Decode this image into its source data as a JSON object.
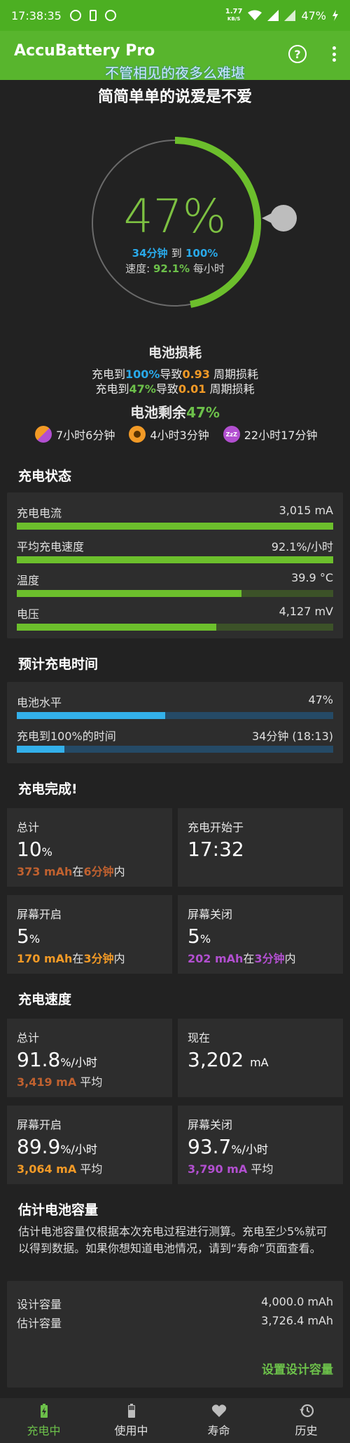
{
  "statusbar": {
    "time": "17:38:35",
    "netspeed_value": "1.77",
    "netspeed_unit": "KB/S",
    "battery": "47%"
  },
  "appbar": {
    "title": "AccuBattery Pro",
    "help_glyph": "?"
  },
  "lyrics": {
    "line1": "不管相见的夜多么难堪",
    "line2": "简简单单的说爱是不爱"
  },
  "gauge": {
    "level_percent": 47,
    "big_label": "47%",
    "time_to": "34分钟",
    "to_word": "到",
    "target": "100%",
    "speed_label": "速度:",
    "speed_value": "92.1%",
    "speed_unit": "每小时"
  },
  "wear": {
    "title": "电池损耗",
    "line1": {
      "pre": "充电到",
      "target": "100%",
      "mid": "导致",
      "value": "0.93",
      "post": "周期损耗"
    },
    "line2": {
      "pre": "充电到",
      "target": "47%",
      "mid": "导致",
      "value": "0.01",
      "post": "周期损耗"
    }
  },
  "remaining": {
    "label": "电池剩余",
    "value": "47%",
    "estimates": [
      {
        "icon": "half-screen-icon",
        "text": "7小时6分钟"
      },
      {
        "icon": "screen-on-icon",
        "text": "4小时3分钟"
      },
      {
        "icon": "screen-off-icon",
        "icon_text": "ZzZ",
        "text": "22小时17分钟"
      }
    ]
  },
  "charge_status": {
    "title": "充电状态",
    "rows": [
      {
        "label": "充电电流",
        "value": "3,015 mA",
        "fill": 1.0
      },
      {
        "label": "平均充电速度",
        "value": "92.1%/小时",
        "fill": 1.0
      },
      {
        "label": "温度",
        "value": "39.9 °C",
        "fill": 0.71
      },
      {
        "label": "电压",
        "value": "4,127 mV",
        "fill": 0.63
      }
    ]
  },
  "charge_time": {
    "title": "预计充电时间",
    "rows": [
      {
        "label": "电池水平",
        "value": "47%",
        "fill": 0.47
      },
      {
        "label": "充电到100%的时间",
        "value": "34分钟 (18:13)",
        "fill": 0.15
      }
    ]
  },
  "charge_done": {
    "title": "充电完成!",
    "tiles": [
      {
        "label": "总计",
        "big": "10",
        "unit": "%",
        "sub_amount": "373 mAh",
        "sub_mid": "在",
        "sub_time": "6分钟",
        "sub_post": "内"
      },
      {
        "label": "充电开始于",
        "big": "17:32",
        "unit": ""
      },
      {
        "label": "屏幕开启",
        "big": "5",
        "unit": "%",
        "sub_amount": "170 mAh",
        "sub_mid": "在",
        "sub_time": "3分钟",
        "sub_post": "内"
      },
      {
        "label": "屏幕关闭",
        "big": "5",
        "unit": "%",
        "sub_amount": "202 mAh",
        "sub_mid": "在",
        "sub_time": "3分钟",
        "sub_post": "内"
      }
    ]
  },
  "charge_speed": {
    "title": "充电速度",
    "tiles": [
      {
        "label": "总计",
        "big": "91.8",
        "unit": "%/小时",
        "sub_amount": "3,419 mA",
        "sub_post": "平均"
      },
      {
        "label": "现在",
        "big": "3,202",
        "unit": "mA"
      },
      {
        "label": "屏幕开启",
        "big": "89.9",
        "unit": "%/小时",
        "sub_amount": "3,064 mA",
        "sub_post": "平均"
      },
      {
        "label": "屏幕关闭",
        "big": "93.7",
        "unit": "%/小时",
        "sub_amount": "3,790 mA",
        "sub_post": "平均"
      }
    ]
  },
  "capacity": {
    "title": "估计电池容量",
    "desc": "估计电池容量仅根据本次充电过程进行测算。充电至少5%就可以得到数据。如果你想知道电池情况，请到“寿命”页面查看。",
    "rows": [
      {
        "label": "设计容量",
        "value": "4,000.0 mAh"
      },
      {
        "label": "估计容量",
        "value": "3,726.4 mAh"
      }
    ],
    "link": "设置设计容量"
  },
  "bottomnav": [
    {
      "label": "充电中",
      "icon": "battery-charging-icon",
      "active": true
    },
    {
      "label": "使用中",
      "icon": "battery-icon",
      "active": false
    },
    {
      "label": "寿命",
      "icon": "heart-icon",
      "active": false
    },
    {
      "label": "历史",
      "icon": "history-icon",
      "active": false
    }
  ],
  "colors": {
    "accent": "#58b52d",
    "background": "#222222",
    "card": "#2d2d2d",
    "blue": "#29a9e9",
    "orange": "#f29a26",
    "purple": "#b24fd0"
  }
}
